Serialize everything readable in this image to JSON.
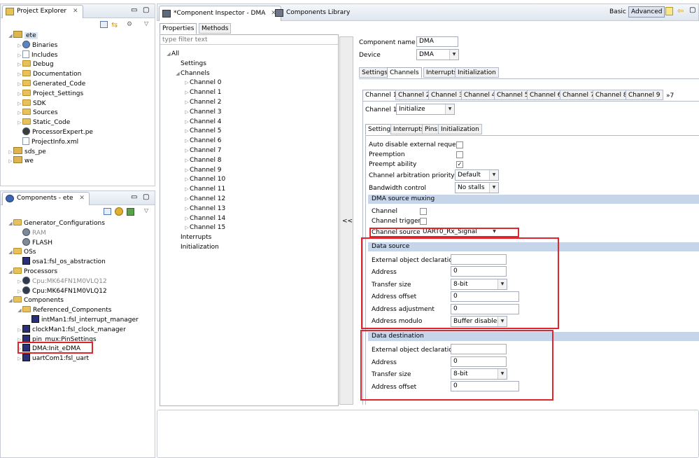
{
  "project_explorer": {
    "title": "Project Explorer",
    "close": "✕",
    "tree": [
      {
        "label": "ete",
        "level": 0,
        "icon": "project",
        "expanded": true,
        "selected": true
      },
      {
        "label": "Binaries",
        "level": 1,
        "icon": "binaries"
      },
      {
        "label": "Includes",
        "level": 1,
        "icon": "includes"
      },
      {
        "label": "Debug",
        "level": 1,
        "icon": "folder"
      },
      {
        "label": "Documentation",
        "level": 1,
        "icon": "folder"
      },
      {
        "label": "Generated_Code",
        "level": 1,
        "icon": "folder"
      },
      {
        "label": "Project_Settings",
        "level": 1,
        "icon": "folder"
      },
      {
        "label": "SDK",
        "level": 1,
        "icon": "folder"
      },
      {
        "label": "Sources",
        "level": 1,
        "icon": "folder"
      },
      {
        "label": "Static_Code",
        "level": 1,
        "icon": "folder"
      },
      {
        "label": "ProcessorExpert.pe",
        "level": 1,
        "icon": "pe-file",
        "leaf": true
      },
      {
        "label": "ProjectInfo.xml",
        "level": 1,
        "icon": "file",
        "leaf": true
      },
      {
        "label": "sds_pe",
        "level": 0,
        "icon": "project"
      },
      {
        "label": "we",
        "level": 0,
        "icon": "project"
      }
    ]
  },
  "components_view": {
    "title": "Components - ete",
    "close": "✕",
    "tree": [
      {
        "label": "Generator_Configurations",
        "level": 0,
        "icon": "folder",
        "expanded": true
      },
      {
        "label": "RAM",
        "level": 1,
        "icon": "gear",
        "gray": true,
        "leaf": true
      },
      {
        "label": "FLASH",
        "level": 1,
        "icon": "gear",
        "leaf": true
      },
      {
        "label": "OSs",
        "level": 0,
        "icon": "folder",
        "expanded": true
      },
      {
        "label": "osa1:fsl_os_abstraction",
        "level": 1,
        "icon": "component",
        "leaf": true
      },
      {
        "label": "Processors",
        "level": 0,
        "icon": "folder",
        "expanded": true
      },
      {
        "label": "Cpu:MK64FN1M0VLQ12",
        "level": 1,
        "icon": "cpu",
        "gray": true
      },
      {
        "label": "Cpu:MK64FN1M0VLQ12",
        "level": 1,
        "icon": "cpu"
      },
      {
        "label": "Components",
        "level": 0,
        "icon": "folder",
        "expanded": true
      },
      {
        "label": "Referenced_Components",
        "level": 1,
        "icon": "folder",
        "expanded": true
      },
      {
        "label": "intMan1:fsl_interrupt_manager",
        "level": 2,
        "icon": "component",
        "leaf": true
      },
      {
        "label": "clockMan1:fsl_clock_manager",
        "level": 1,
        "icon": "component"
      },
      {
        "label": "pin_mux:PinSettings",
        "level": 1,
        "icon": "component"
      },
      {
        "label": "DMA:Init_eDMA",
        "level": 1,
        "icon": "component",
        "highlight": true
      },
      {
        "label": "uartCom1:fsl_uart",
        "level": 1,
        "icon": "component"
      }
    ]
  },
  "editor_tabs": {
    "inspector": "*Component Inspector - DMA",
    "library": "Components Library",
    "basic": "Basic",
    "advanced": "Advanced"
  },
  "inspector_left": {
    "tabs": [
      "Properties",
      "Methods"
    ],
    "filter_placeholder": "type filter text",
    "collapse_btn": "<<",
    "tree": [
      {
        "label": "All",
        "level": 0,
        "expanded": true
      },
      {
        "label": "Settings",
        "level": 1,
        "leaf": true
      },
      {
        "label": "Channels",
        "level": 1,
        "expanded": true
      },
      {
        "label": "Channel 0",
        "level": 2
      },
      {
        "label": "Channel 1",
        "level": 2
      },
      {
        "label": "Channel 2",
        "level": 2
      },
      {
        "label": "Channel 3",
        "level": 2
      },
      {
        "label": "Channel 4",
        "level": 2
      },
      {
        "label": "Channel 5",
        "level": 2
      },
      {
        "label": "Channel 6",
        "level": 2
      },
      {
        "label": "Channel 7",
        "level": 2
      },
      {
        "label": "Channel 8",
        "level": 2
      },
      {
        "label": "Channel 9",
        "level": 2
      },
      {
        "label": "Channel 10",
        "level": 2
      },
      {
        "label": "Channel 11",
        "level": 2
      },
      {
        "label": "Channel 12",
        "level": 2
      },
      {
        "label": "Channel 13",
        "level": 2
      },
      {
        "label": "Channel 14",
        "level": 2
      },
      {
        "label": "Channel 15",
        "level": 2
      },
      {
        "label": "Interrupts",
        "level": 1,
        "leaf": true
      },
      {
        "label": "Initialization",
        "level": 1,
        "leaf": true
      }
    ]
  },
  "inspector_right": {
    "component_name_label": "Component name",
    "component_name_value": "DMA",
    "device_label": "Device",
    "device_value": "DMA",
    "main_tabs": [
      "Settings",
      "Channels",
      "Interrupts",
      "Initialization"
    ],
    "channel_tabs": [
      "Channel 1",
      "Channel 2",
      "Channel 3",
      "Channel 4",
      "Channel 5",
      "Channel 6",
      "Channel 7",
      "Channel 8",
      "Channel 9"
    ],
    "channel_more": "»7",
    "channel1_label": "Channel 1",
    "channel1_value": "Initialize",
    "sub_tabs": [
      "Settings",
      "Interrupts",
      "Pins",
      "Initialization"
    ],
    "props": {
      "auto_disable": {
        "label": "Auto disable external request",
        "checked": false
      },
      "preemption": {
        "label": "Preemption",
        "checked": false
      },
      "preempt_ability": {
        "label": "Preempt ability",
        "checked": true
      },
      "arb_priority": {
        "label": "Channel arbitration priority",
        "value": "Default"
      },
      "bandwidth": {
        "label": "Bandwidth control",
        "value": "No stalls"
      }
    },
    "dma_muxing": {
      "title": "DMA source muxing",
      "channel": {
        "label": "Channel",
        "checked": false
      },
      "trigger": {
        "label": "Channel trigger",
        "checked": false
      },
      "source": {
        "label": "Channel source",
        "value": "UART0_Rx_Signal"
      }
    },
    "data_source": {
      "title": "Data source",
      "ext_label": "External object declaration",
      "ext_value": "",
      "address_label": "Address",
      "address_value": "0",
      "transfer_label": "Transfer size",
      "transfer_value": "8-bit",
      "offset_label": "Address offset",
      "offset_value": "0",
      "adjust_label": "Address adjustment",
      "adjust_value": "0",
      "modulo_label": "Address modulo",
      "modulo_value": "Buffer disabled"
    },
    "data_destination": {
      "title": "Data destination",
      "ext_label": "External object declaration",
      "ext_value": "",
      "address_label": "Address",
      "address_value": "0",
      "transfer_label": "Transfer size",
      "transfer_value": "8-bit",
      "offset_label": "Address offset",
      "offset_value": "0"
    }
  }
}
